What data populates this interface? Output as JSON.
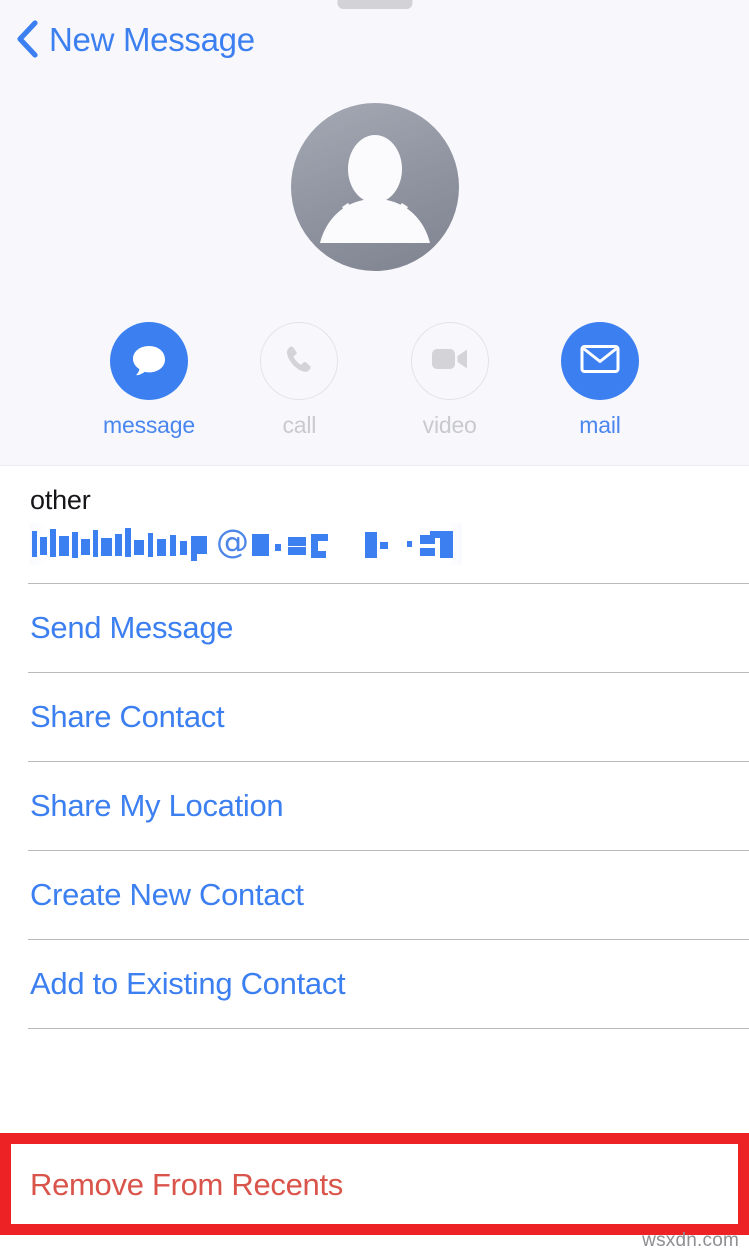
{
  "header": {
    "back_label": "New Message",
    "back_icon": "chevron-left-icon",
    "drag_handle": "sheet-drag-handle",
    "avatar_icon": "person-placeholder-avatar",
    "accent_color": "#3c7ff0",
    "panel_background": "#f8f8fc"
  },
  "actions": [
    {
      "id": "message",
      "label": "message",
      "icon": "message-bubble-icon",
      "enabled": true,
      "circle_color": "#3c7ff0"
    },
    {
      "id": "call",
      "label": "call",
      "icon": "phone-icon",
      "enabled": false,
      "circle_color": "#e2e2e8"
    },
    {
      "id": "video",
      "label": "video",
      "icon": "video-camera-icon",
      "enabled": false,
      "circle_color": "#e2e2e8"
    },
    {
      "id": "mail",
      "label": "mail",
      "icon": "envelope-icon",
      "enabled": true,
      "circle_color": "#3c7ff0"
    }
  ],
  "contact_field": {
    "label": "other",
    "value": "",
    "value_redacted": true,
    "value_note": "email address obscured by pixelation",
    "at_symbol": "@"
  },
  "menu_items": [
    {
      "id": "send-message",
      "label": "Send Message"
    },
    {
      "id": "share-contact",
      "label": "Share Contact"
    },
    {
      "id": "share-my-location",
      "label": "Share My Location"
    },
    {
      "id": "create-new-contact",
      "label": "Create New Contact"
    },
    {
      "id": "add-to-existing-contact",
      "label": "Add to Existing Contact"
    }
  ],
  "destructive": {
    "label": "Remove From Recents",
    "text_color": "#d9544b",
    "annotation_color": "#ed2224"
  },
  "watermark": {
    "text": "wsxdn.com"
  }
}
